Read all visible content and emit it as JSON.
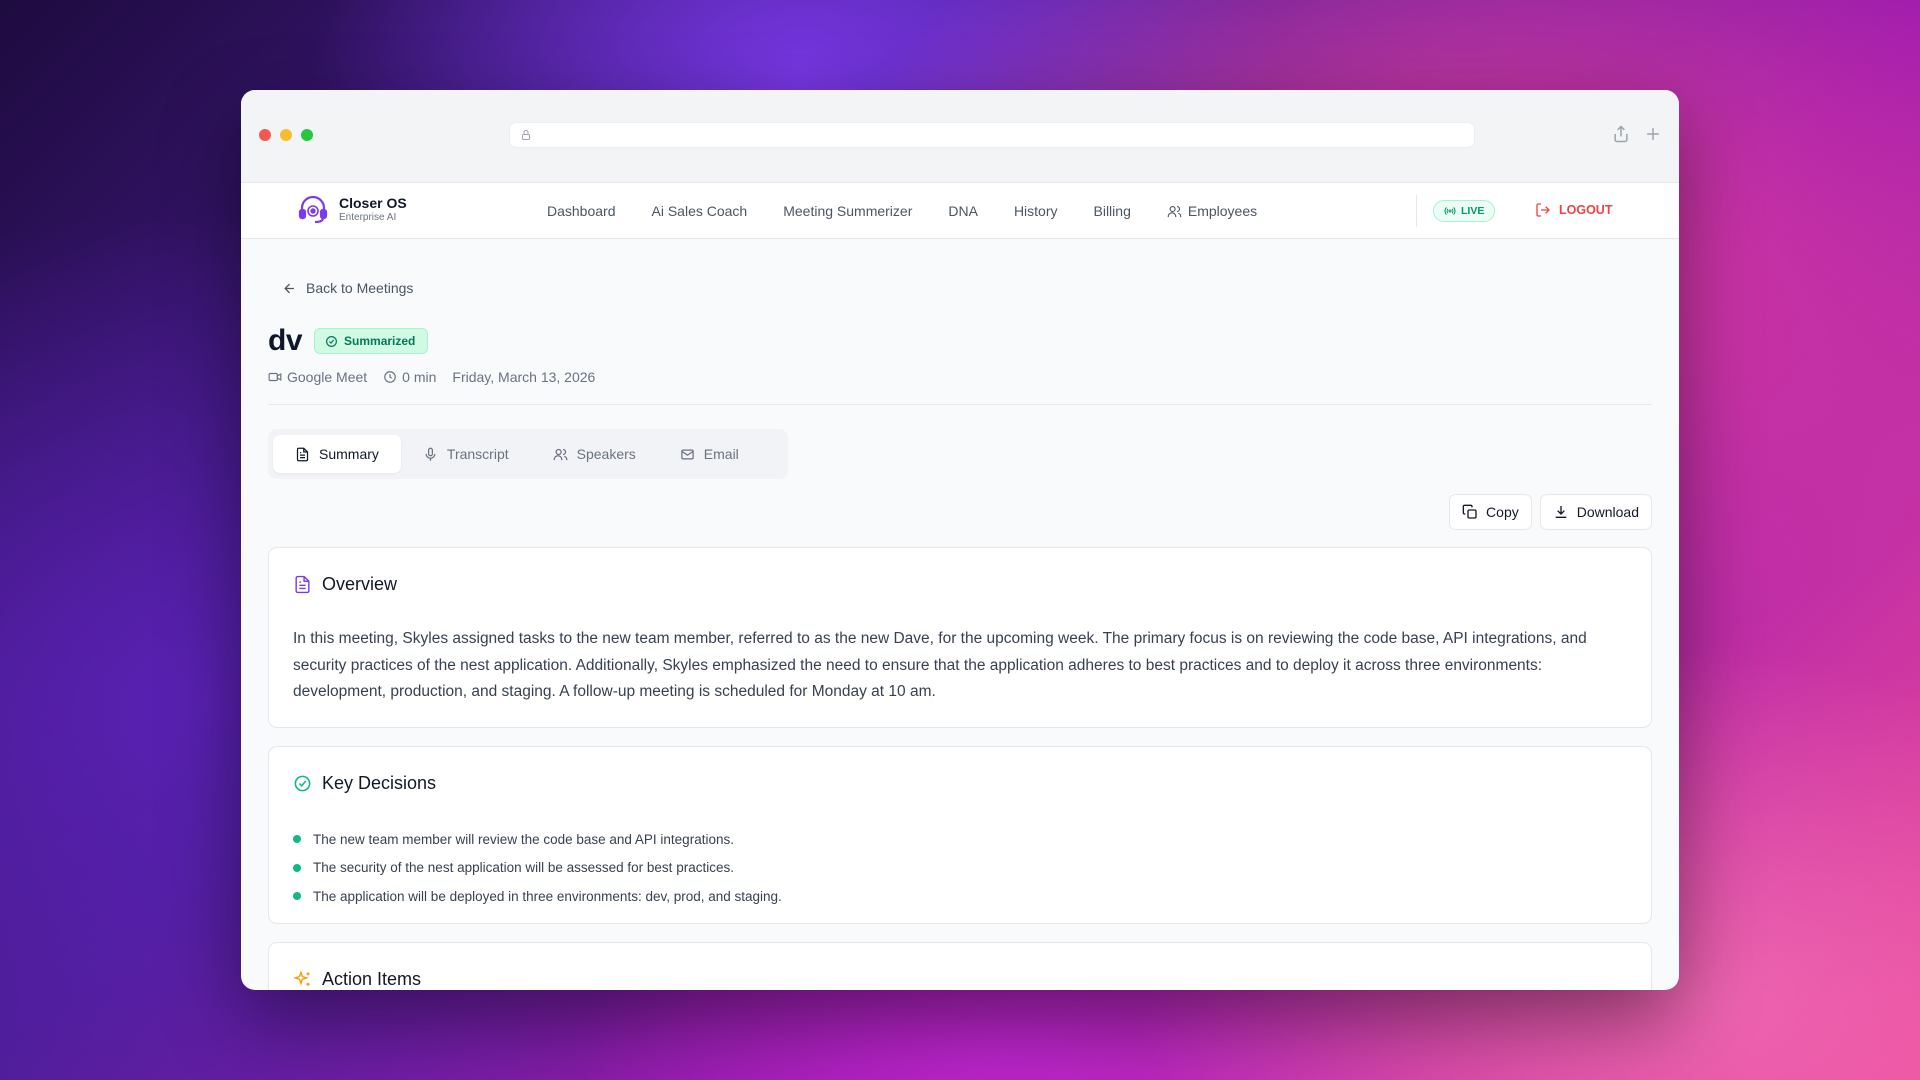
{
  "nav": {
    "brand_name": "Closer OS",
    "brand_sub": "Enterprise AI",
    "links": [
      "Dashboard",
      "Ai Sales Coach",
      "Meeting Summerizer",
      "DNA",
      "History",
      "Billing",
      "Employees"
    ],
    "live": "LIVE",
    "logout": "LOGOUT"
  },
  "page": {
    "back": "Back to Meetings",
    "title": "dv",
    "status": "Summarized",
    "platform": "Google Meet",
    "duration": "0 min",
    "date": "Friday, March 13, 2026"
  },
  "tabs": [
    "Summary",
    "Transcript",
    "Speakers",
    "Email"
  ],
  "actions": {
    "copy": "Copy",
    "download": "Download"
  },
  "overview": {
    "title": "Overview",
    "text": "In this meeting, Skyles assigned tasks to the new team member, referred to as the new Dave, for the upcoming week. The primary focus is on reviewing the code base, API integrations, and security practices of the nest application. Additionally, Skyles emphasized the need to ensure that the application adheres to best practices and to deploy it across three environments: development, production, and staging. A follow-up meeting is scheduled for Monday at 10 am."
  },
  "key_decisions": {
    "title": "Key Decisions",
    "items": [
      "The new team member will review the code base and API integrations.",
      "The security of the nest application will be assessed for best practices.",
      "The application will be deployed in three environments: dev, prod, and staging."
    ]
  },
  "action_items": {
    "title": "Action Items"
  },
  "colors": {
    "accent": "#7c3aed",
    "success": "#10b981",
    "danger": "#ef4444",
    "warning": "#f59e0b"
  }
}
